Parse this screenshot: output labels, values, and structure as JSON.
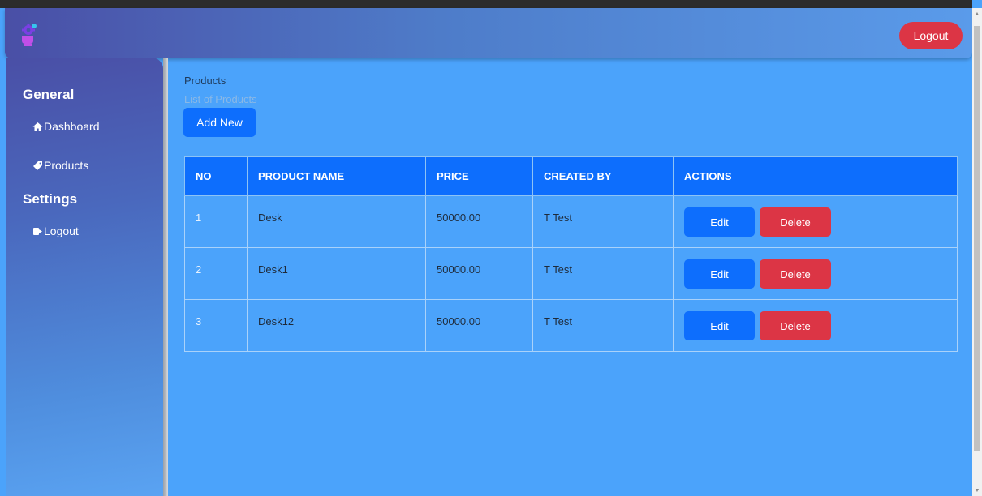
{
  "navbar": {
    "logout_label": "Logout"
  },
  "sidebar": {
    "general_heading": "General",
    "settings_heading": "Settings",
    "items": [
      {
        "label": "Dashboard",
        "icon": "home-icon"
      },
      {
        "label": "Products",
        "icon": "tag-icon"
      },
      {
        "label": "Logout",
        "icon": "logout-icon"
      }
    ]
  },
  "main": {
    "title": "Products",
    "subtitle": "List of Products",
    "add_label": "Add New",
    "table": {
      "headers": [
        "NO",
        "PRODUCT NAME",
        "PRICE",
        "CREATED BY",
        "ACTIONS"
      ],
      "rows": [
        {
          "no": "1",
          "name": "Desk",
          "price": "50000.00",
          "created_by": "T Test"
        },
        {
          "no": "2",
          "name": "Desk1",
          "price": "50000.00",
          "created_by": "T Test"
        },
        {
          "no": "3",
          "name": "Desk12",
          "price": "50000.00",
          "created_by": "T Test"
        }
      ],
      "edit_label": "Edit",
      "delete_label": "Delete"
    }
  },
  "colors": {
    "background": "#4ba3fb",
    "primary": "#0d6efd",
    "danger": "#dc3545"
  }
}
